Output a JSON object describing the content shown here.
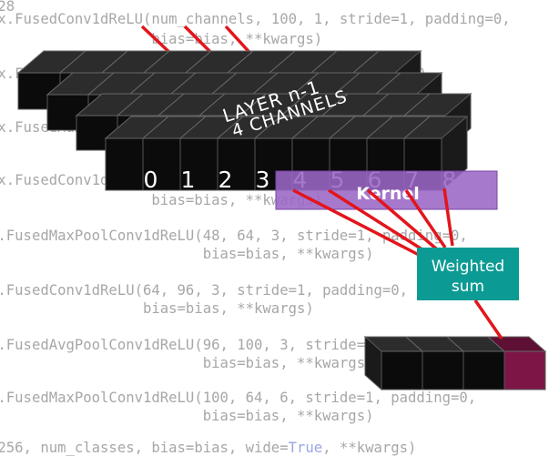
{
  "code_lines": [
    {
      "text": "128",
      "kw": ""
    },
    {
      "text": "nx.FusedConv1dReLU(num_channels, 100, 1, stride=1, padding=0,",
      "kw": ""
    },
    {
      "text": "                   bias=bias, **kwargs)",
      "kw": ""
    },
    {
      "text": "nx.FusedConv1dReLU(100, 100, 3, stride=1, padding=0,",
      "kw": ""
    },
    {
      "text": "nx.FusedMaxPoolConv1dReLU(100, 100, 3, stride=1,",
      "kw": ""
    },
    {
      "text": "nx.FusedConv1dReLU(100, 48, 3, stride=1, padding=0,",
      "kw": ""
    },
    {
      "text": "                   bias=bias, **kwargs)",
      "kw": ""
    },
    {
      "text": "x.FusedMaxPoolConv1dReLU(48, 64, 3, stride=1, padding=0,",
      "kw": ""
    },
    {
      "text": "                         bias=bias, **kwargs)",
      "kw": ""
    },
    {
      "text": "x.FusedConv1dReLU(64, 96, 3, stride=1, padding=0,",
      "kw": ""
    },
    {
      "text": "                  bias=bias, **kwargs)",
      "kw": ""
    },
    {
      "text": "x.FusedAvgPoolConv1dReLU(96, 100, 3, stride=1, padding=0,",
      "kw": ""
    },
    {
      "text": "                         bias=bias, **kwargs)",
      "kw": ""
    },
    {
      "text": "x.FusedMaxPoolConv1dReLU(100, 64, 6, stride=1, padding=0,",
      "kw": ""
    },
    {
      "text": "                         bias=bias, **kwargs)",
      "kw": ""
    },
    {
      "text": "(256, num_classes, bias=bias, wide=True, **kwargs)",
      "kw": "True"
    }
  ],
  "layer_label_line1": "LAYER n-1",
  "layer_label_line2": "4 CHANNELS",
  "cell_numbers": [
    "0",
    "1",
    "2",
    "3",
    "4",
    "5",
    "6",
    "7",
    "8"
  ],
  "kernel_label": "Kernel",
  "weighted_sum_line1": "Weighted",
  "weighted_sum_line2": "sum",
  "colors": {
    "cube_front": "#0b0b0b",
    "cube_top": "#2c2c2c",
    "cube_side": "#1a1a1a",
    "kernel_fill": "#9a66c6",
    "weighted_sum_fill": "#0c9b94",
    "connector_red": "#e3151c",
    "output_accent": "#7d1646",
    "code_text": "#a7a7a7"
  }
}
